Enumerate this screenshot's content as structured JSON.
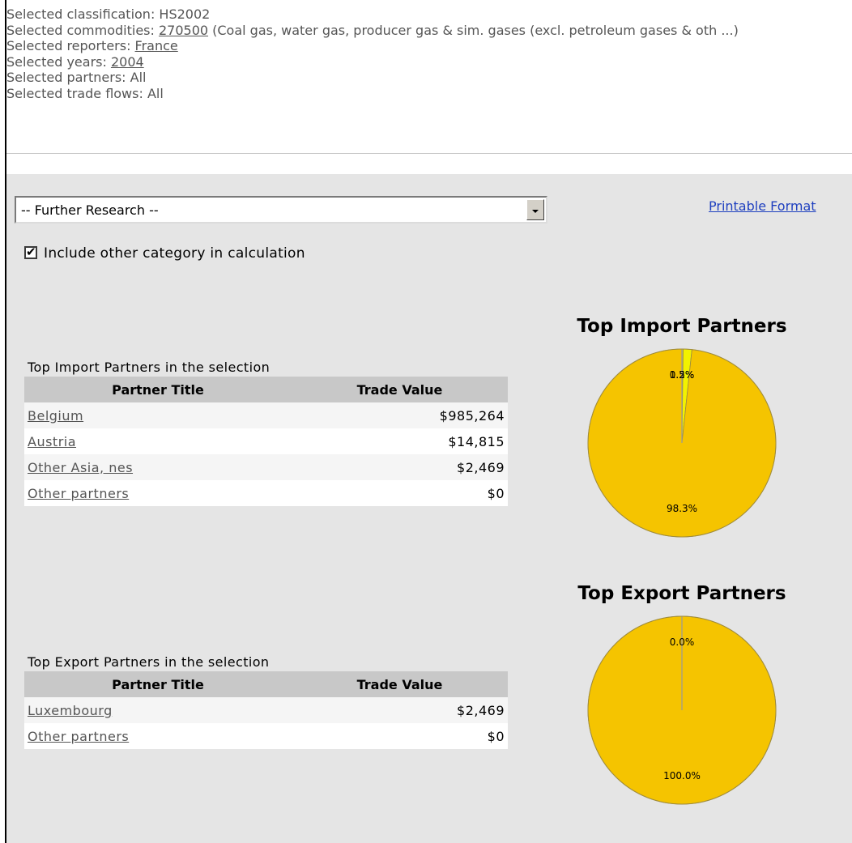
{
  "summary": {
    "classification": "Selected classification: HS2002",
    "commodities_prefix": "Selected commodities: ",
    "commodity_code": "270500",
    "commodity_desc": " (Coal gas, water gas, producer gas & sim. gases (excl. petroleum gases & oth ...)",
    "reporters_prefix": "Selected reporters: ",
    "reporter": "France",
    "years_prefix": "Selected years: ",
    "year": "2004",
    "partners": "Selected partners: All",
    "flows": "Selected trade flows: All"
  },
  "toolbar": {
    "further_research": "-- Further Research --",
    "printable": "Printable Format",
    "include_other_label": "Include other category in calculation",
    "include_other_checked": true
  },
  "imports": {
    "caption": "Top Import Partners in the selection",
    "col_partner": "Partner Title",
    "col_value": "Trade Value",
    "rows": [
      {
        "partner": "Belgium",
        "value": "$985,264"
      },
      {
        "partner": "Austria",
        "value": "$14,815"
      },
      {
        "partner": "Other Asia, nes",
        "value": "$2,469"
      },
      {
        "partner": "Other partners",
        "value": "$0"
      }
    ]
  },
  "exports": {
    "caption": "Top Export Partners in the selection",
    "col_partner": "Partner Title",
    "col_value": "Trade Value",
    "rows": [
      {
        "partner": "Luxembourg",
        "value": "$2,469"
      },
      {
        "partner": "Other partners",
        "value": "$0"
      }
    ]
  },
  "chart_data": [
    {
      "type": "pie",
      "title": "Top Import Partners",
      "slices": [
        {
          "label": "98.3%",
          "value": 98.3,
          "color": "#f5c400"
        },
        {
          "label": "1.5%",
          "value": 1.5,
          "color": "#f2f200"
        },
        {
          "label": "0.2%",
          "value": 0.2,
          "color": "#cdcd4a"
        }
      ]
    },
    {
      "type": "pie",
      "title": "Top Export Partners",
      "slices": [
        {
          "label": "100.0%",
          "value": 100.0,
          "color": "#f5c400"
        },
        {
          "label": "0.0%",
          "value": 0.0,
          "color": "#aaaaaa"
        }
      ]
    }
  ]
}
